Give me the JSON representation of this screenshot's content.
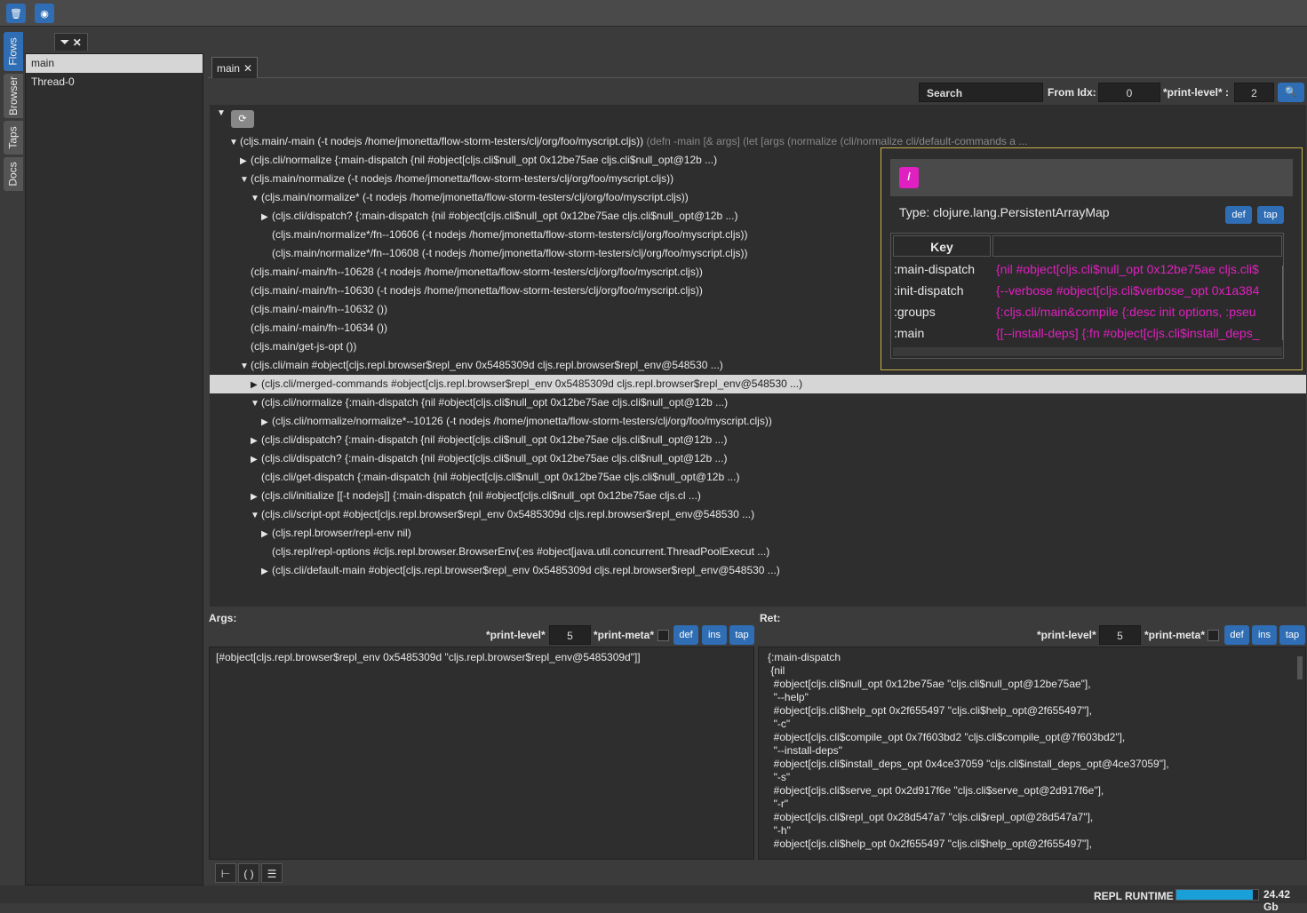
{
  "toolbar": {
    "btn1_icon": "trash-icon",
    "btn2_icon": "record-icon"
  },
  "vtabs": [
    "Flows",
    "Browser",
    "Taps",
    "Docs"
  ],
  "threads": [
    "main",
    "Thread-0"
  ],
  "main_tab": {
    "label": "main"
  },
  "search": {
    "label": "Search",
    "from_idx_label": "From Idx:",
    "from_idx": "0",
    "print_level_label": "*print-level* :",
    "print_level": "2"
  },
  "tree": [
    {
      "indent": 0,
      "arrow": "▼",
      "text": "(cljs.main/-main (-t nodejs /home/jmonetta/flow-storm-testers/clj/org/foo/myscript.cljs))",
      "faded": " (defn -main [& args] (let [args (normalize (cli/normalize cli/default-commands a ..."
    },
    {
      "indent": 1,
      "arrow": "▶",
      "text": "(cljs.cli/normalize {:main-dispatch {nil #object[cljs.cli$null_opt 0x12be75ae cljs.cli$null_opt@12b ...)"
    },
    {
      "indent": 1,
      "arrow": "▼",
      "text": "(cljs.main/normalize (-t nodejs /home/jmonetta/flow-storm-testers/clj/org/foo/myscript.cljs))"
    },
    {
      "indent": 2,
      "arrow": "▼",
      "text": "(cljs.main/normalize* (-t nodejs /home/jmonetta/flow-storm-testers/clj/org/foo/myscript.cljs))"
    },
    {
      "indent": 3,
      "arrow": "▶",
      "text": "(cljs.cli/dispatch? {:main-dispatch {nil #object[cljs.cli$null_opt 0x12be75ae cljs.cli$null_opt@12b ...)"
    },
    {
      "indent": 3,
      "arrow": "",
      "text": "(cljs.main/normalize*/fn--10606 (-t nodejs /home/jmonetta/flow-storm-testers/clj/org/foo/myscript.cljs))"
    },
    {
      "indent": 3,
      "arrow": "",
      "text": "(cljs.main/normalize*/fn--10608 (-t nodejs /home/jmonetta/flow-storm-testers/clj/org/foo/myscript.cljs))"
    },
    {
      "indent": 1,
      "arrow": "",
      "text": "(cljs.main/-main/fn--10628 (-t nodejs /home/jmonetta/flow-storm-testers/clj/org/foo/myscript.cljs))"
    },
    {
      "indent": 1,
      "arrow": "",
      "text": "(cljs.main/-main/fn--10630 (-t nodejs /home/jmonetta/flow-storm-testers/clj/org/foo/myscript.cljs))"
    },
    {
      "indent": 1,
      "arrow": "",
      "text": "(cljs.main/-main/fn--10632 ())"
    },
    {
      "indent": 1,
      "arrow": "",
      "text": "(cljs.main/-main/fn--10634 ())"
    },
    {
      "indent": 1,
      "arrow": "",
      "text": "(cljs.main/get-js-opt ())"
    },
    {
      "indent": 1,
      "arrow": "▼",
      "text": "(cljs.cli/main #object[cljs.repl.browser$repl_env 0x5485309d cljs.repl.browser$repl_env@548530 ...)"
    },
    {
      "indent": 2,
      "arrow": "▶",
      "text": "(cljs.cli/merged-commands #object[cljs.repl.browser$repl_env 0x5485309d cljs.repl.browser$repl_env@548530 ...)",
      "highlight": true
    },
    {
      "indent": 2,
      "arrow": "▼",
      "text": "(cljs.cli/normalize {:main-dispatch {nil #object[cljs.cli$null_opt 0x12be75ae cljs.cli$null_opt@12b ...)"
    },
    {
      "indent": 3,
      "arrow": "▶",
      "text": "(cljs.cli/normalize/normalize*--10126 (-t nodejs /home/jmonetta/flow-storm-testers/clj/org/foo/myscript.cljs))"
    },
    {
      "indent": 2,
      "arrow": "▶",
      "text": "(cljs.cli/dispatch? {:main-dispatch {nil #object[cljs.cli$null_opt 0x12be75ae cljs.cli$null_opt@12b ...)"
    },
    {
      "indent": 2,
      "arrow": "▶",
      "text": "(cljs.cli/dispatch? {:main-dispatch {nil #object[cljs.cli$null_opt 0x12be75ae cljs.cli$null_opt@12b ...)"
    },
    {
      "indent": 2,
      "arrow": "",
      "text": "(cljs.cli/get-dispatch {:main-dispatch {nil #object[cljs.cli$null_opt 0x12be75ae cljs.cli$null_opt@12b ...)"
    },
    {
      "indent": 2,
      "arrow": "▶",
      "text": "(cljs.cli/initialize [[-t nodejs]] {:main-dispatch {nil #object[cljs.cli$null_opt 0x12be75ae cljs.cl ...)"
    },
    {
      "indent": 2,
      "arrow": "▼",
      "text": "(cljs.cli/script-opt #object[cljs.repl.browser$repl_env 0x5485309d cljs.repl.browser$repl_env@548530 ...)"
    },
    {
      "indent": 3,
      "arrow": "▶",
      "text": "(cljs.repl.browser/repl-env nil)"
    },
    {
      "indent": 3,
      "arrow": "",
      "text": "(cljs.repl/repl-options #cljs.repl.browser.BrowserEnv{:es #object[java.util.concurrent.ThreadPoolExecut ...)"
    },
    {
      "indent": 3,
      "arrow": "▶",
      "text": "(cljs.cli/default-main #object[cljs.repl.browser$repl_env 0x5485309d cljs.repl.browser$repl_env@548530 ...)"
    }
  ],
  "popup": {
    "path": "/",
    "type_text": "Type: clojure.lang.PersistentArrayMap",
    "def_label": "def",
    "tap_label": "tap",
    "key_header": "Key",
    "rows": [
      {
        "key": ":main-dispatch",
        "val": "{nil #object[cljs.cli$null_opt 0x12be75ae cljs.cli$"
      },
      {
        "key": ":init-dispatch",
        "val": "{--verbose #object[cljs.cli$verbose_opt 0x1a384"
      },
      {
        "key": ":groups",
        "val": "{:cljs.cli/main&compile {:desc init options, :pseu"
      },
      {
        "key": ":main",
        "val": "{[--install-deps] {:fn #object[cljs.cli$install_deps_"
      }
    ]
  },
  "args": {
    "title": "Args:",
    "print_level_label": "*print-level*",
    "print_level": "5",
    "print_meta_label": "*print-meta*",
    "def_label": "def",
    "ins_label": "ins",
    "tap_label": "tap",
    "value": "[#object[cljs.repl.browser$repl_env 0x5485309d \"cljs.repl.browser$repl_env@5485309d\"]]"
  },
  "ret": {
    "title": "Ret:",
    "print_level_label": "*print-level*",
    "print_level": "5",
    "print_meta_label": "*print-meta*",
    "def_label": "def",
    "ins_label": "ins",
    "tap_label": "tap",
    "lines": [
      "{:main-dispatch",
      " {nil",
      "  #object[cljs.cli$null_opt 0x12be75ae \"cljs.cli$null_opt@12be75ae\"],",
      "  \"--help\"",
      "  #object[cljs.cli$help_opt 0x2f655497 \"cljs.cli$help_opt@2f655497\"],",
      "  \"-c\"",
      "  #object[cljs.cli$compile_opt 0x7f603bd2 \"cljs.cli$compile_opt@7f603bd2\"],",
      "  \"--install-deps\"",
      "  #object[cljs.cli$install_deps_opt 0x4ce37059 \"cljs.cli$install_deps_opt@4ce37059\"],",
      "  \"-s\"",
      "  #object[cljs.cli$serve_opt 0x2d917f6e \"cljs.cli$serve_opt@2d917f6e\"],",
      "  \"-r\"",
      "  #object[cljs.cli$repl_opt 0x28d547a7 \"cljs.cli$repl_opt@28d547a7\"],",
      "  \"-h\"",
      "  #object[cljs.cli$help_opt 0x2f655497 \"cljs.cli$help_opt@2f655497\"],"
    ]
  },
  "bottom_tools": [
    "tree-icon",
    "parens-icon",
    "list-icon"
  ],
  "status": {
    "repl": "REPL",
    "runtime": "RUNTIME",
    "memory_fraction": 0.93,
    "memory": "24.42 Gb"
  },
  "colors": {
    "accent": "#2f6db4",
    "magenta": "#e020c0",
    "popup_border": "#c9b24a"
  }
}
